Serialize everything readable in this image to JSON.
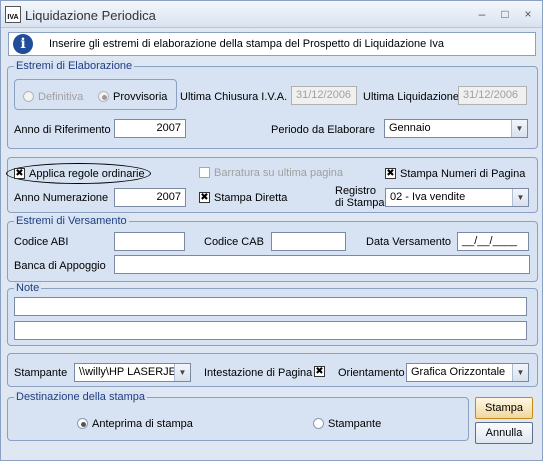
{
  "window": {
    "title": "Liquidazione Periodica",
    "icon_text": "IVA"
  },
  "info": {
    "text": "Inserire gli estremi di elaborazione della stampa del Prospetto di Liquidazione Iva"
  },
  "elaborazione": {
    "legend": "Estremi di Elaborazione",
    "radio_definitiva": "Definitiva",
    "radio_provvisoria": "Provvisoria",
    "ultima_chiusura_label": "Ultima Chiusura I.V.A.",
    "ultima_chiusura_value": "31/12/2006",
    "ultima_liquidazione_label": "Ultima Liquidazione",
    "ultima_liquidazione_value": "31/12/2006",
    "anno_label": "Anno di Riferimento",
    "anno_value": "2007",
    "periodo_label": "Periodo da Elaborare",
    "periodo_value": "Gennaio"
  },
  "opzioni": {
    "applica_label": "Applica regole ordinarie",
    "barratura_label": "Barratura su ultima pagina",
    "stampa_numeri_label": "Stampa Numeri di Pagina",
    "anno_num_label": "Anno Numerazione",
    "anno_num_value": "2007",
    "stampa_diretta_label": "Stampa Diretta",
    "registro_label_1": "Registro",
    "registro_label_2": "di Stampa",
    "registro_value": "02 - Iva vendite"
  },
  "versamento": {
    "legend": "Estremi di Versamento",
    "abi_label": "Codice ABI",
    "cab_label": "Codice CAB",
    "data_label": "Data Versamento",
    "data_value": "__/__/____",
    "banca_label": "Banca di Appoggio"
  },
  "note": {
    "legend": "Note"
  },
  "stampante": {
    "label": "Stampante",
    "value": "\\\\willy\\HP LASERJE",
    "intestazione_label": "Intestazione di Pagina",
    "orientamento_label": "Orientamento",
    "orientamento_value": "Grafica Orizzontale"
  },
  "destinazione": {
    "legend": "Destinazione della stampa",
    "anteprima": "Anteprima di stampa",
    "stampante": "Stampante"
  },
  "buttons": {
    "stampa": "Stampa",
    "annulla": "Annulla"
  }
}
